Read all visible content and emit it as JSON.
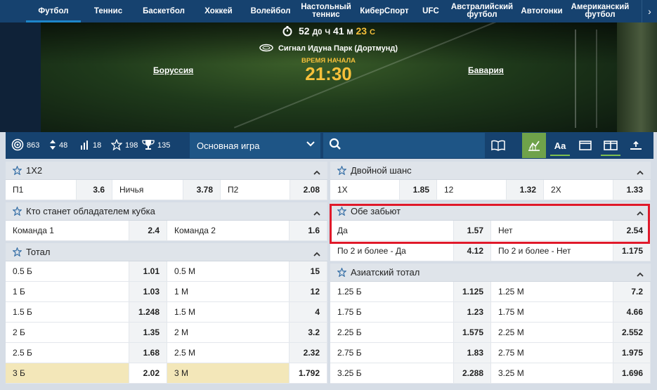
{
  "nav": {
    "items": [
      {
        "label": "Футбол",
        "active": true
      },
      {
        "label": "Теннис"
      },
      {
        "label": "Баскетбол"
      },
      {
        "label": "Хоккей"
      },
      {
        "label": "Волейбол"
      },
      {
        "label": "Настольный\nтеннис"
      },
      {
        "label": "КиберСпорт"
      },
      {
        "label": "UFC"
      },
      {
        "label": "Австралийский\nфутбол"
      },
      {
        "label": "Автогонки"
      },
      {
        "label": "Американский\nфутбол"
      }
    ],
    "scroll_icon": "chevron-right-icon"
  },
  "match": {
    "timer": {
      "days": "52",
      "days_unit": "Д",
      "hours_unit": "Ч",
      "hours": "41",
      "minutes_unit": "М",
      "seconds": "23",
      "seconds_unit": "С",
      "zero": "0"
    },
    "stadium": "Сигнал Идуна Парк (Дортмунд)",
    "start_label": "ВРЕМЯ НАЧАЛА",
    "start_time": "21:30",
    "home": "Боруссия",
    "away": "Бавария"
  },
  "toolbar": {
    "counters": [
      {
        "icon": "target-icon",
        "value": "863"
      },
      {
        "icon": "sort-arrows-icon",
        "value": "48"
      },
      {
        "icon": "bars-icon",
        "value": "18"
      },
      {
        "icon": "star-icon",
        "value": "198"
      },
      {
        "icon": "trophy-icon",
        "value": "135"
      }
    ],
    "select_value": "Основная игра",
    "tools": [
      "book-icon",
      "stats-icon",
      "font-size-icon",
      "single-column-icon",
      "two-column-icon",
      "pin-icon"
    ]
  },
  "left": {
    "p1x2": {
      "title": "1Х2",
      "rows": [
        [
          [
            "П1",
            "3.6"
          ],
          [
            "Ничья",
            "3.78"
          ],
          [
            "П2",
            "2.08"
          ]
        ]
      ]
    },
    "cup": {
      "title": "Кто станет обладателем кубка",
      "rows": [
        [
          [
            "Команда 1",
            "2.4"
          ],
          [
            "Команда 2",
            "1.6"
          ]
        ]
      ]
    },
    "total": {
      "title": "Тотал",
      "rows": [
        [
          [
            "0.5 Б",
            "1.01"
          ],
          [
            "0.5 М",
            "15"
          ]
        ],
        [
          [
            "1 Б",
            "1.03"
          ],
          [
            "1 М",
            "12"
          ]
        ],
        [
          [
            "1.5 Б",
            "1.248"
          ],
          [
            "1.5 М",
            "4"
          ]
        ],
        [
          [
            "2 Б",
            "1.35"
          ],
          [
            "2 М",
            "3.2"
          ]
        ],
        [
          [
            "2.5 Б",
            "1.68"
          ],
          [
            "2.5 М",
            "2.32"
          ]
        ],
        [
          [
            "3 Б",
            "2.02"
          ],
          [
            "3 М",
            "1.792"
          ]
        ]
      ]
    }
  },
  "right": {
    "double": {
      "title": "Двойной шанс",
      "rows": [
        [
          [
            "1Х",
            "1.85"
          ],
          [
            "12",
            "1.32"
          ],
          [
            "2Х",
            "1.33"
          ]
        ]
      ]
    },
    "btts": {
      "title": "Обе забьют",
      "rows": [
        [
          [
            "Да",
            "1.57"
          ],
          [
            "Нет",
            "2.54"
          ]
        ],
        [
          [
            "По 2 и более - Да",
            "4.12"
          ],
          [
            "По 2 и более - Нет",
            "1.175"
          ]
        ]
      ]
    },
    "asian": {
      "title": "Азиатский тотал",
      "rows": [
        [
          [
            "1.25 Б",
            "1.125"
          ],
          [
            "1.25 М",
            "7.2"
          ]
        ],
        [
          [
            "1.75 Б",
            "1.23"
          ],
          [
            "1.75 М",
            "4.66"
          ]
        ],
        [
          [
            "2.25 Б",
            "1.575"
          ],
          [
            "2.25 М",
            "2.552"
          ]
        ],
        [
          [
            "2.75 Б",
            "1.83"
          ],
          [
            "2.75 М",
            "1.975"
          ]
        ],
        [
          [
            "3.25 Б",
            "2.288"
          ],
          [
            "3.25 М",
            "1.696"
          ]
        ]
      ]
    }
  },
  "colors": {
    "nav_bg": "#16426f",
    "accent_gold": "#f6c03a",
    "highlight_row": "#f3e7b9",
    "selection_box": "#e0192a"
  }
}
